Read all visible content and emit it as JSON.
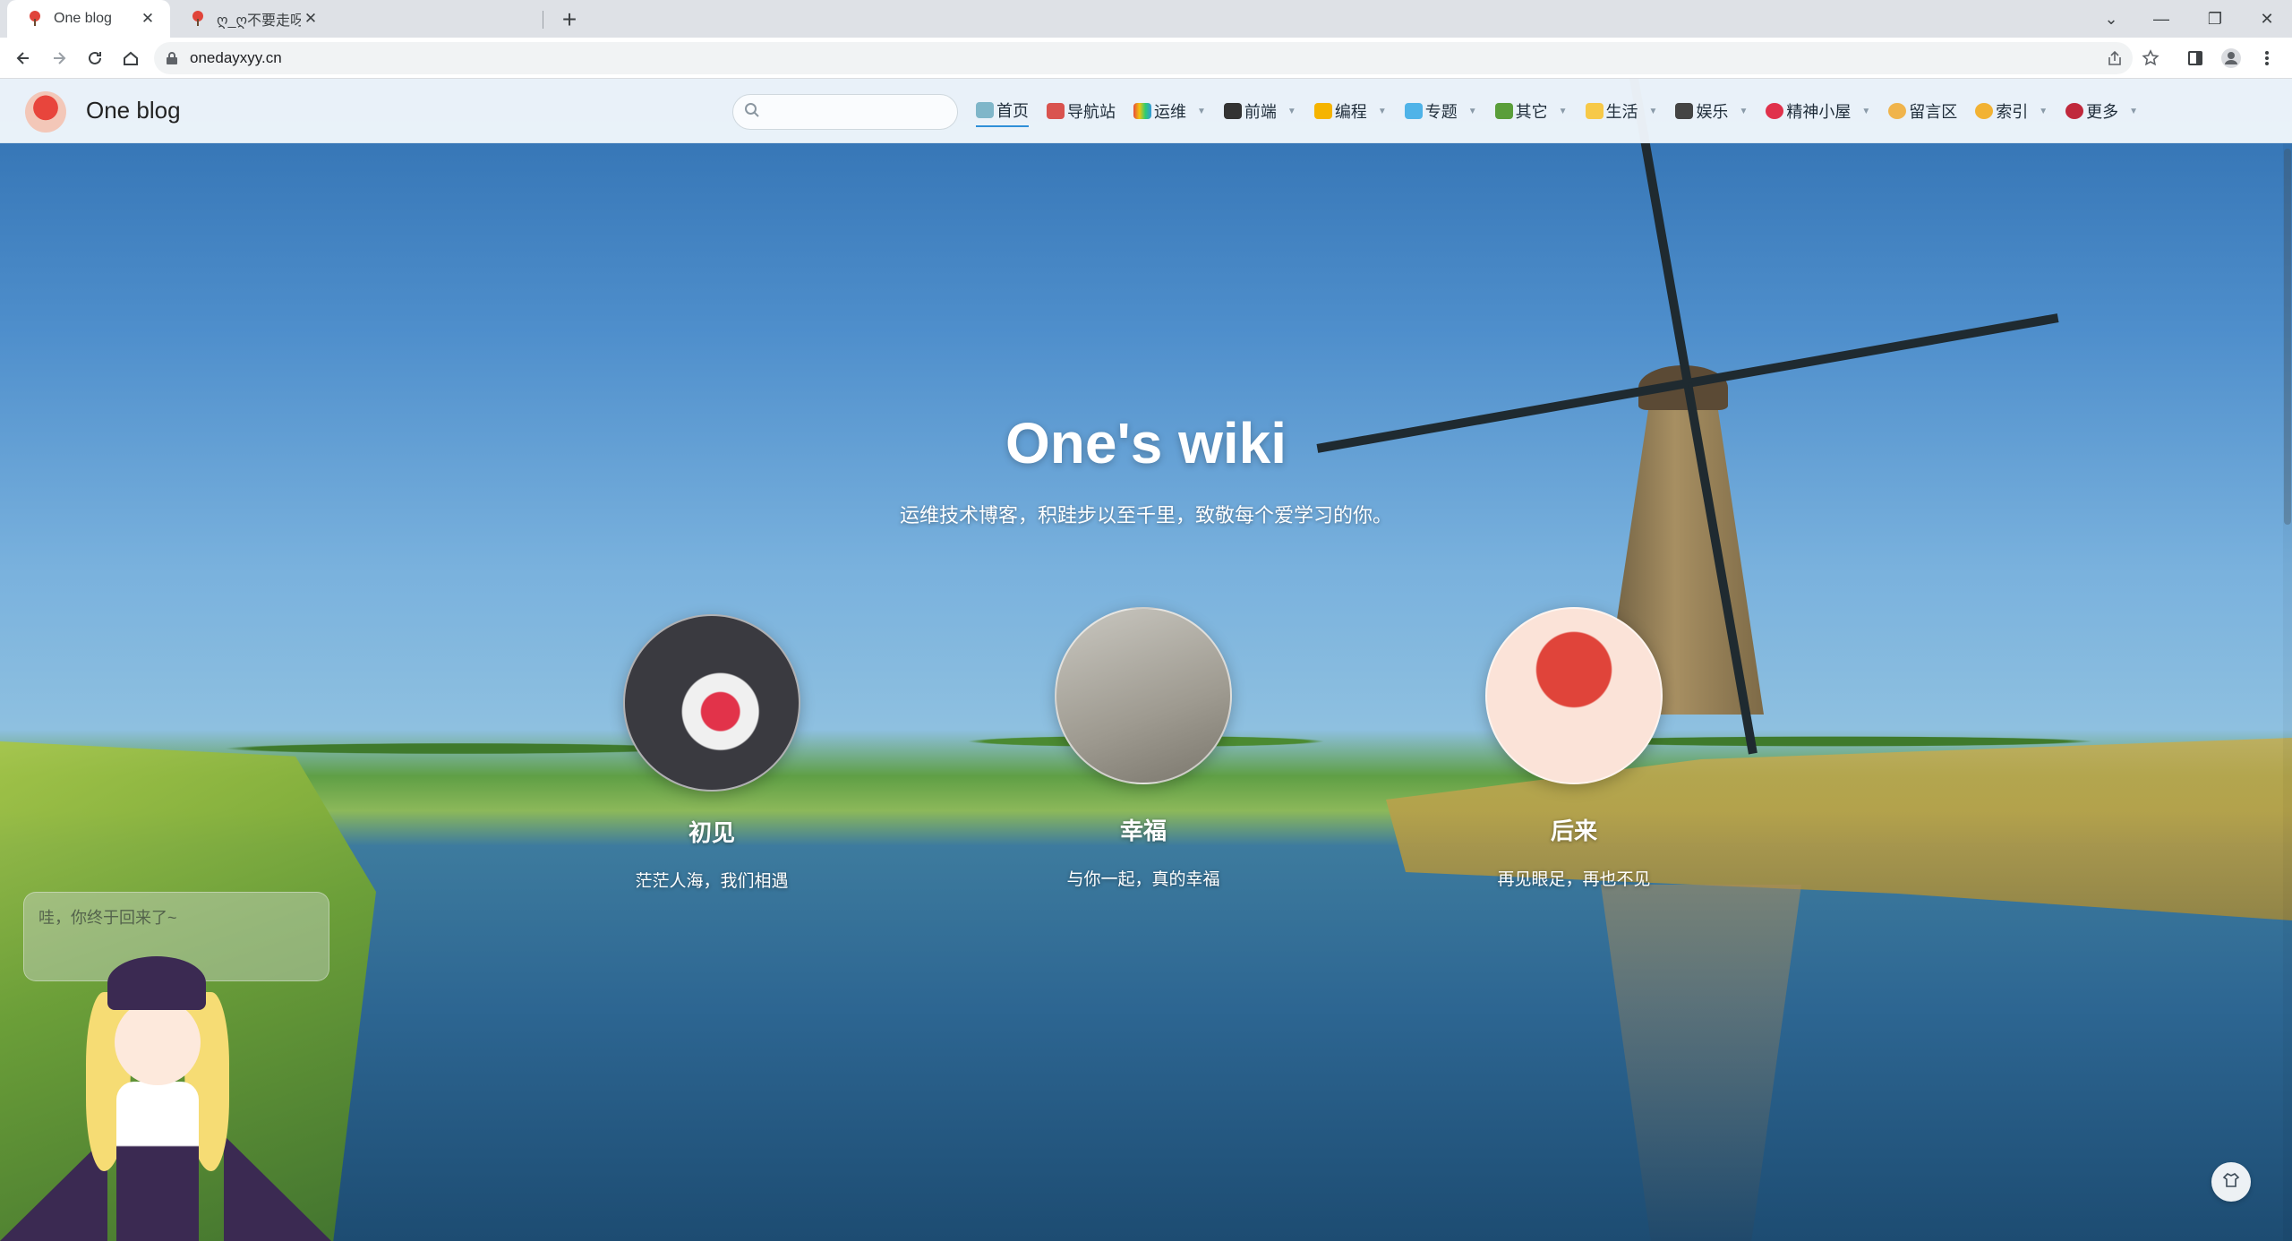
{
  "browser": {
    "tabs": [
      {
        "title": "One blog",
        "active": true
      },
      {
        "title": "ღ_ღ不要走呀!",
        "active": false
      }
    ],
    "new_tab": "+",
    "url": "onedayxyy.cn"
  },
  "site": {
    "brand": "One blog",
    "search": {
      "placeholder": ""
    },
    "nav": [
      {
        "label": "首页",
        "icon": "home-icon",
        "has_dropdown": false,
        "active": true
      },
      {
        "label": "导航站",
        "icon": "megaphone-icon",
        "has_dropdown": false
      },
      {
        "label": "运维",
        "icon": "rainbow-icon",
        "has_dropdown": true
      },
      {
        "label": "前端",
        "icon": "book-icon",
        "has_dropdown": true
      },
      {
        "label": "编程",
        "icon": "lightning-icon",
        "has_dropdown": true
      },
      {
        "label": "专题",
        "icon": "gem-icon",
        "has_dropdown": true
      },
      {
        "label": "其它",
        "icon": "turtle-icon",
        "has_dropdown": true
      },
      {
        "label": "生活",
        "icon": "star-icon",
        "has_dropdown": true
      },
      {
        "label": "娱乐",
        "icon": "camera-icon",
        "has_dropdown": true
      },
      {
        "label": "精神小屋",
        "icon": "heart-icon",
        "has_dropdown": true
      },
      {
        "label": "留言区",
        "icon": "ear-icon",
        "has_dropdown": false
      },
      {
        "label": "索引",
        "icon": "hand-icon",
        "has_dropdown": true
      },
      {
        "label": "更多",
        "icon": "rose-icon",
        "has_dropdown": true
      }
    ]
  },
  "hero": {
    "title": "One's wiki",
    "subtitle": "运维技术博客，积跬步以至千里，致敬每个爱学习的你。",
    "cards": [
      {
        "title": "初见",
        "text": "茫茫人海，我们相遇"
      },
      {
        "title": "幸福",
        "text": "与你一起，真的幸福"
      },
      {
        "title": "后来",
        "text": "再见眼足，再也不见"
      }
    ]
  },
  "mascot": {
    "bubble_text": "哇，你终于回来了~"
  },
  "colors": {
    "accent": "#2f8fd8",
    "header_bg": "#f0f7fc"
  }
}
